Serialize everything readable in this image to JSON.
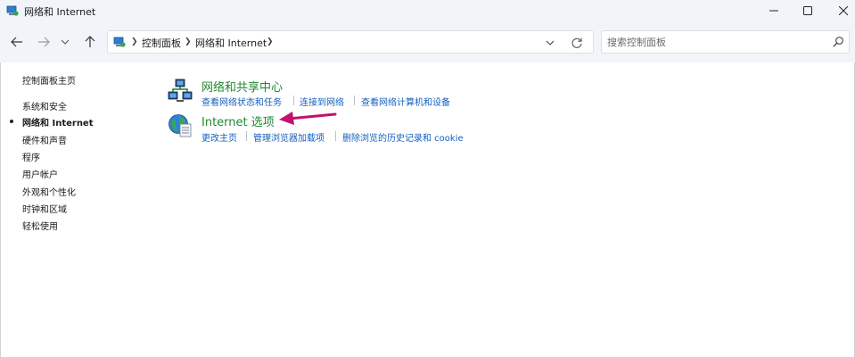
{
  "window": {
    "title": "网络和 Internet"
  },
  "address": {
    "crumbs": [
      "控制面板",
      "网络和 Internet"
    ]
  },
  "search": {
    "placeholder": "搜索控制面板"
  },
  "sidebar": {
    "home": "控制面板主页",
    "items": [
      {
        "label": "系统和安全",
        "active": false
      },
      {
        "label": "网络和 Internet",
        "active": true
      },
      {
        "label": "硬件和声音",
        "active": false
      },
      {
        "label": "程序",
        "active": false
      },
      {
        "label": "用户帐户",
        "active": false
      },
      {
        "label": "外观和个性化",
        "active": false
      },
      {
        "label": "时钟和区域",
        "active": false
      },
      {
        "label": "轻松使用",
        "active": false
      }
    ]
  },
  "categories": [
    {
      "title": "网络和共享中心",
      "icon": "network-icon",
      "tasks": [
        "查看网络状态和任务",
        "连接到网络",
        "查看网络计算机和设备"
      ]
    },
    {
      "title": "Internet 选项",
      "icon": "globe-icon",
      "tasks": [
        "更改主页",
        "管理浏览器加载项",
        "删除浏览的历史记录和 cookie"
      ]
    }
  ],
  "colors": {
    "category_title": "#1e8a2f",
    "link": "#1560c0",
    "annotation_arrow": "#c0136e",
    "chrome": "#f1f4f9"
  }
}
